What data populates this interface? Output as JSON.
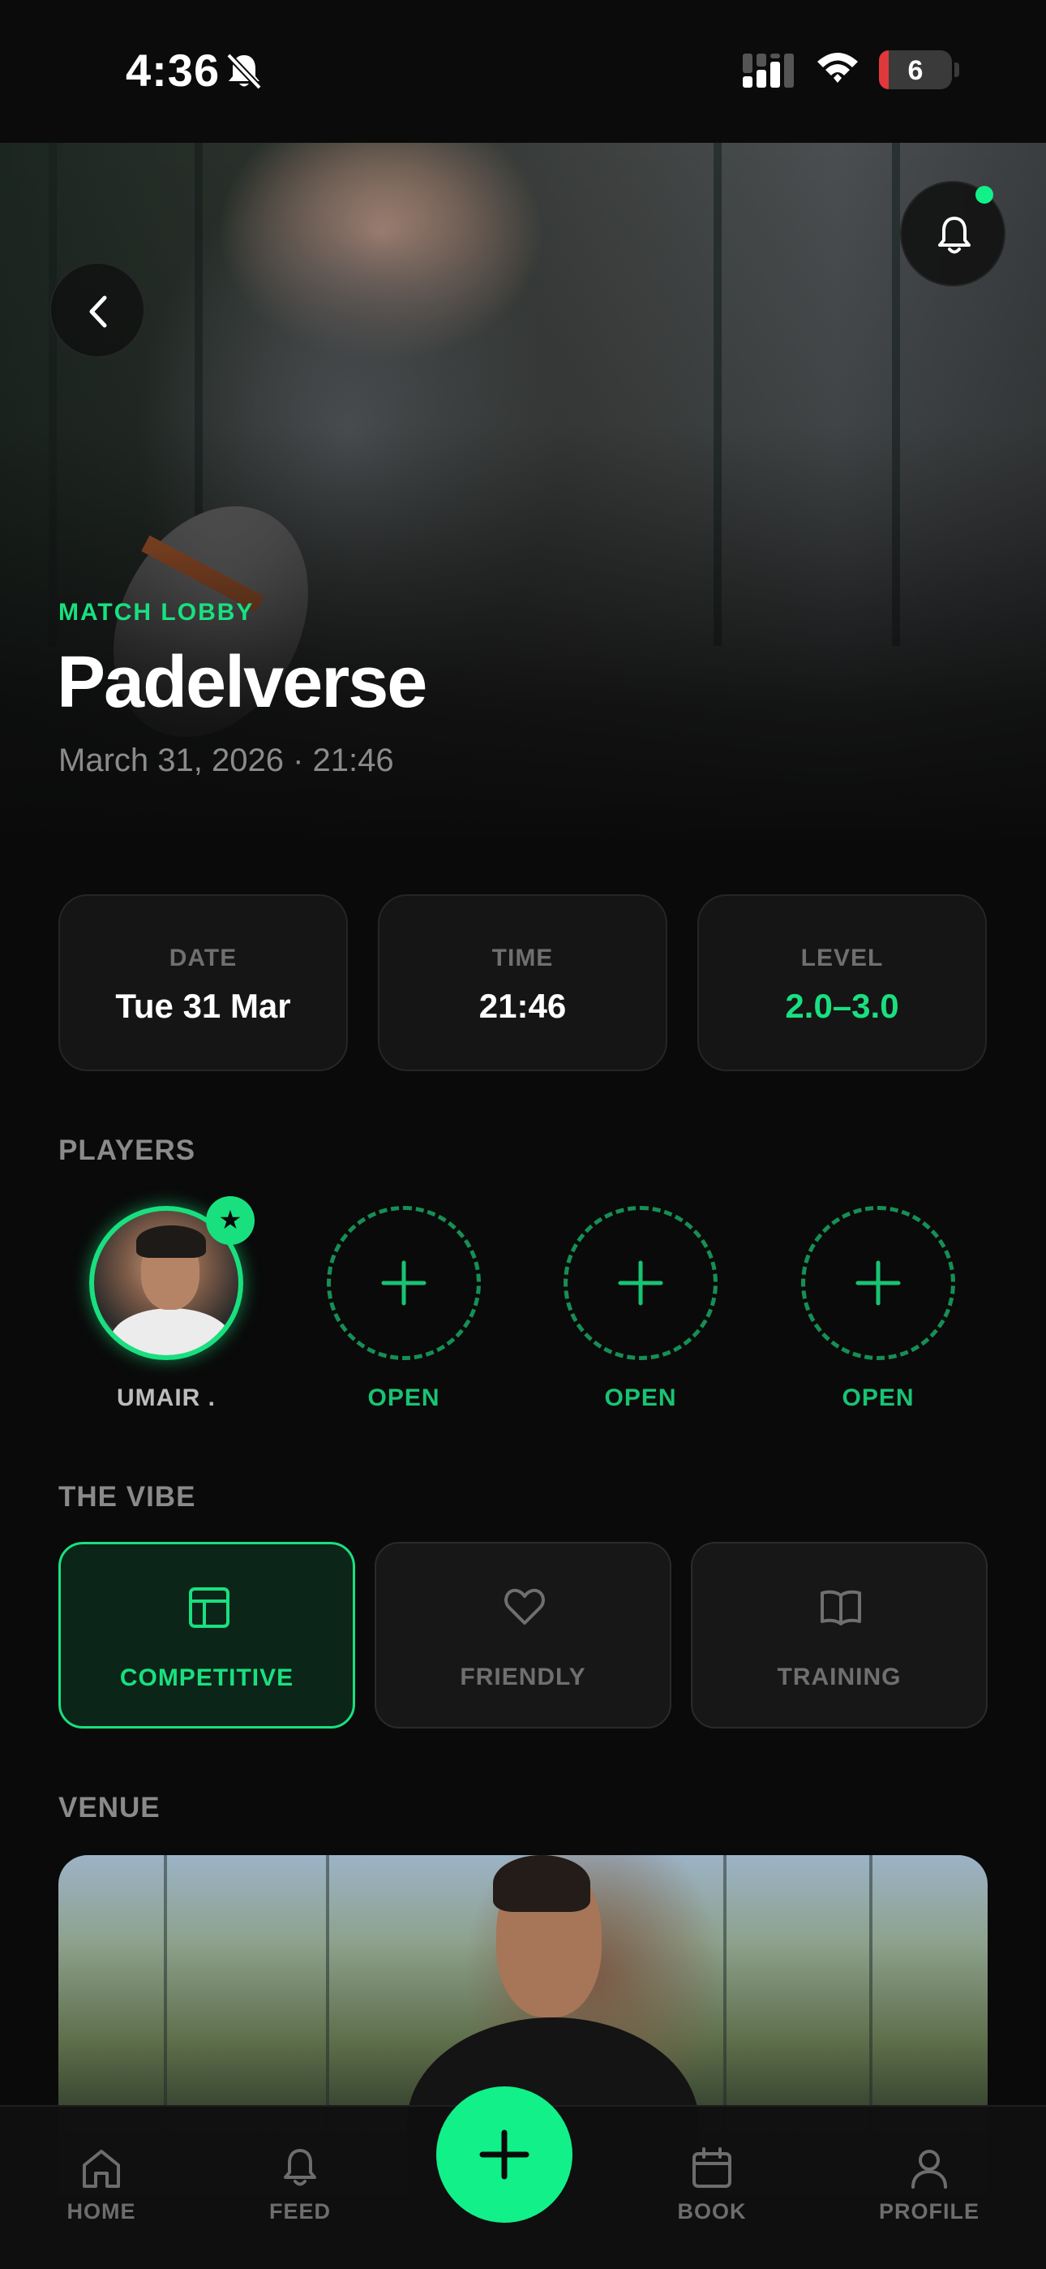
{
  "status_bar": {
    "time": "4:36",
    "battery": "6",
    "icons": [
      "bell-off-icon",
      "signal-icon",
      "wifi-icon",
      "battery-icon"
    ]
  },
  "header": {
    "eyebrow": "MATCH LOBBY",
    "title": "Padelverse",
    "subtitle": "March 31, 2026 · 21:46",
    "back_icon": "chevron-left-icon",
    "notification_icon": "bell-icon"
  },
  "info": {
    "date": {
      "label": "DATE",
      "value": "Tue 31 Mar"
    },
    "time": {
      "label": "TIME",
      "value": "21:46"
    },
    "level": {
      "label": "LEVEL",
      "value": "2.0–3.0"
    }
  },
  "players": {
    "heading": "PLAYERS",
    "slots": [
      {
        "name": "UMAIR .",
        "status": "host"
      },
      {
        "name": "OPEN",
        "status": "open"
      },
      {
        "name": "OPEN",
        "status": "open"
      },
      {
        "name": "OPEN",
        "status": "open"
      }
    ]
  },
  "vibe": {
    "heading": "THE VIBE",
    "options": [
      {
        "label": "COMPETITIVE",
        "icon": "layout-icon",
        "selected": true
      },
      {
        "label": "FRIENDLY",
        "icon": "heart-icon",
        "selected": false
      },
      {
        "label": "TRAINING",
        "icon": "book-icon",
        "selected": false
      }
    ]
  },
  "venue": {
    "heading": "VENUE"
  },
  "nav": {
    "items": [
      {
        "label": "HOME",
        "icon": "home-icon"
      },
      {
        "label": "FEED",
        "icon": "bell-icon"
      },
      {
        "label": "BOOK",
        "icon": "calendar-icon"
      },
      {
        "label": "PROFILE",
        "icon": "user-icon"
      }
    ],
    "fab_icon": "plus-icon"
  },
  "colors": {
    "accent": "#19e07f",
    "fab": "#12f08a",
    "background": "#0a0a0a",
    "card": "#151515"
  }
}
